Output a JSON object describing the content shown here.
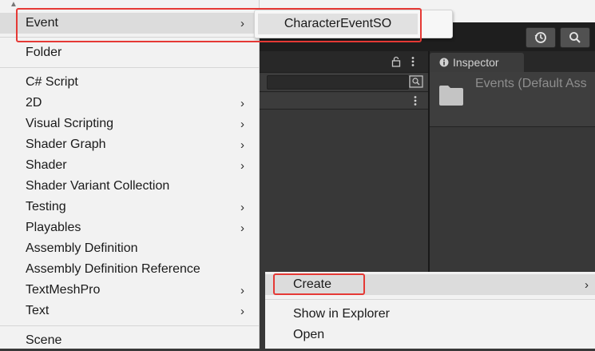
{
  "create_menu": {
    "items": [
      {
        "label": "Event",
        "has_submenu": true
      },
      {
        "label": "Folder",
        "has_submenu": false
      },
      {
        "label": "C# Script",
        "has_submenu": false
      },
      {
        "label": "2D",
        "has_submenu": true
      },
      {
        "label": "Visual Scripting",
        "has_submenu": true
      },
      {
        "label": "Shader Graph",
        "has_submenu": true
      },
      {
        "label": "Shader",
        "has_submenu": true
      },
      {
        "label": "Shader Variant Collection",
        "has_submenu": false
      },
      {
        "label": "Testing",
        "has_submenu": true
      },
      {
        "label": "Playables",
        "has_submenu": true
      },
      {
        "label": "Assembly Definition",
        "has_submenu": false
      },
      {
        "label": "Assembly Definition Reference",
        "has_submenu": false
      },
      {
        "label": "TextMeshPro",
        "has_submenu": true
      },
      {
        "label": "Text",
        "has_submenu": true
      },
      {
        "label": "Scene",
        "has_submenu": false
      }
    ],
    "arrow_glyph": "›",
    "highlighted": "Event"
  },
  "event_submenu": {
    "items": [
      {
        "label": "CharacterEventSO"
      }
    ]
  },
  "project_context_menu": {
    "items": [
      {
        "label": "Create",
        "has_submenu": true
      },
      {
        "label": "Show in Explorer",
        "has_submenu": false
      },
      {
        "label": "Open",
        "has_submenu": false
      }
    ],
    "highlighted": "Create"
  },
  "inspector": {
    "tab_label": "Inspector",
    "object_title": "Events (Default Ass"
  },
  "icons": {
    "history": "history-icon",
    "search": "search-icon",
    "lock": "lock-icon",
    "kebab": "kebab-menu-icon",
    "info": "info-icon",
    "folder": "folder-icon"
  },
  "colors": {
    "highlight_box": "#e53935",
    "menu_bg": "#f2f2f2",
    "editor_bg": "#383838"
  }
}
